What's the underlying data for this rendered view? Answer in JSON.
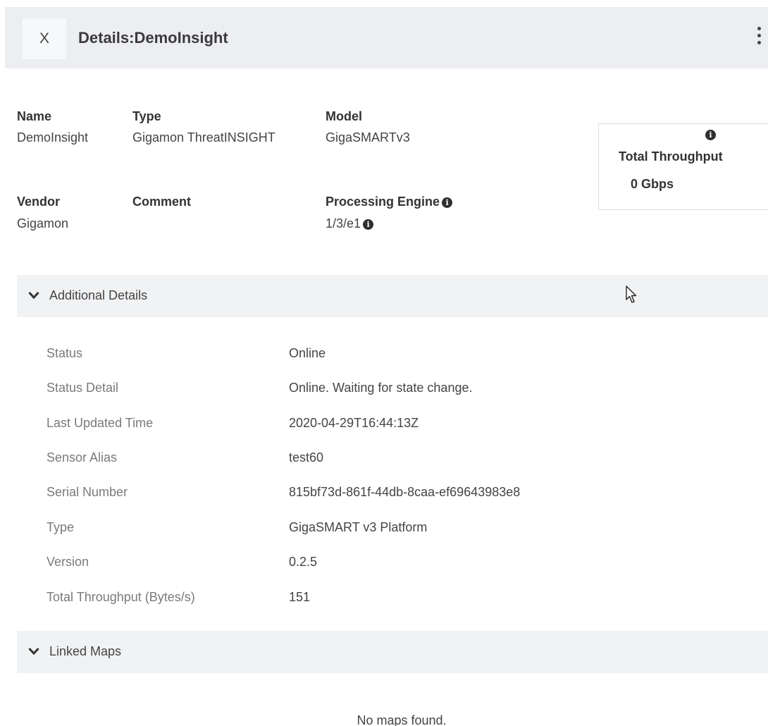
{
  "header": {
    "close_label": "X",
    "title": "Details:DemoInsight"
  },
  "summary": {
    "name_label": "Name",
    "name_value": "DemoInsight",
    "type_label": "Type",
    "type_value": "Gigamon ThreatINSIGHT",
    "model_label": "Model",
    "model_value": "GigaSMARTv3",
    "vendor_label": "Vendor",
    "vendor_value": "Gigamon",
    "comment_label": "Comment",
    "comment_value": "",
    "engine_label": "Processing Engine",
    "engine_value": "1/3/e1"
  },
  "throughput": {
    "title": "Total Throughput",
    "value": "0 Gbps"
  },
  "additional_details": {
    "title": "Additional Details",
    "rows": [
      {
        "label": "Status",
        "value": "Online"
      },
      {
        "label": "Status Detail",
        "value": "Online. Waiting for state change."
      },
      {
        "label": "Last Updated Time",
        "value": "2020-04-29T16:44:13Z"
      },
      {
        "label": "Sensor Alias",
        "value": "test60"
      },
      {
        "label": "Serial Number",
        "value": "815bf73d-861f-44db-8caa-ef69643983e8"
      },
      {
        "label": "Type",
        "value": "GigaSMART v3 Platform"
      },
      {
        "label": "Version",
        "value": "0.2.5"
      },
      {
        "label": "Total Throughput (Bytes/s)",
        "value": "151"
      }
    ]
  },
  "linked_maps": {
    "title": "Linked Maps",
    "empty_message": "No maps found."
  },
  "icons": {
    "info": "info-icon",
    "chevron": "chevron-down-icon",
    "more": "more-vertical-icon",
    "cursor": "mouse-cursor-icon"
  }
}
